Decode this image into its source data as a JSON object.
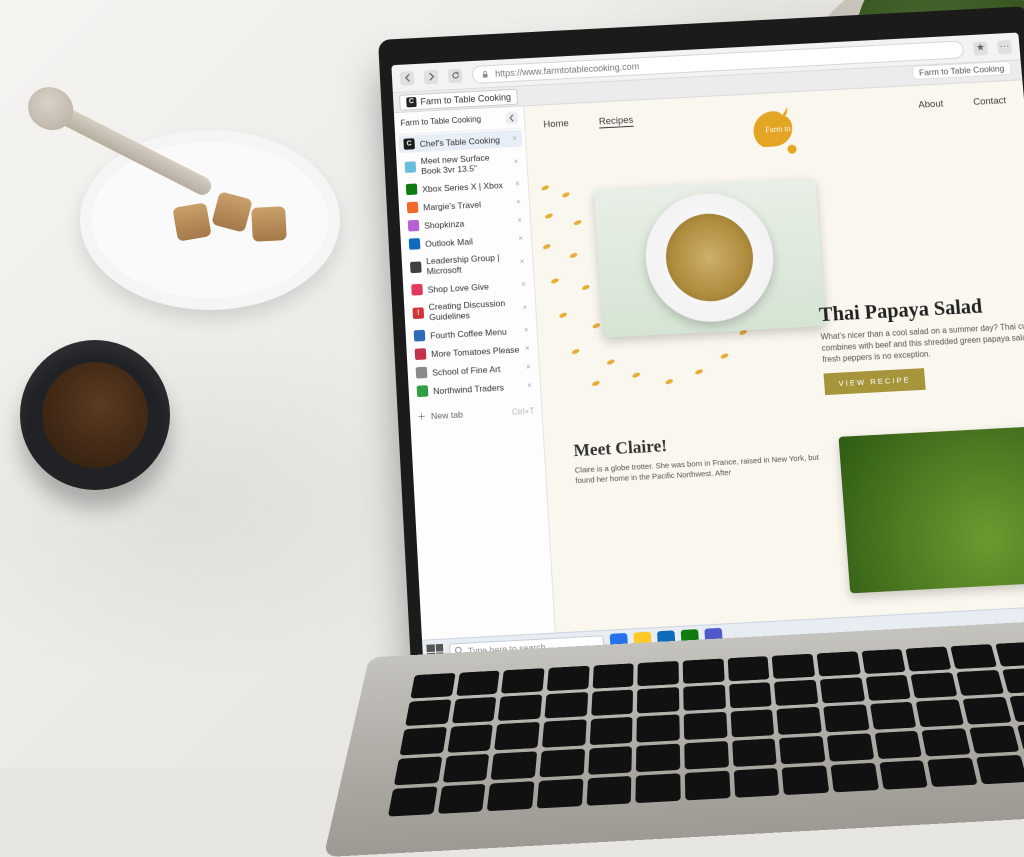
{
  "browser": {
    "url": "https://www.farmtotablecooking.com",
    "account_label": "Farm to Table Cooking",
    "tabstrip_label": "Farm to Table Cooking",
    "sidebar_header": "Farm to Table Cooking",
    "new_tab_label": "New tab",
    "new_tab_shortcut": "Ctrl+T",
    "tabs": [
      {
        "label": "Chef's Table Cooking",
        "color": "#1b1b1b",
        "glyph": "C",
        "active": true
      },
      {
        "label": "Meet new Surface Book 3vr 13.5\"",
        "color": "#6bbedb",
        "glyph": ""
      },
      {
        "label": "Xbox Series X | Xbox",
        "color": "#107c10",
        "glyph": ""
      },
      {
        "label": "Margie's Travel",
        "color": "#f06a2c",
        "glyph": ""
      },
      {
        "label": "Shopkinza",
        "color": "#b560d6",
        "glyph": ""
      },
      {
        "label": "Outlook Mail",
        "color": "#0f6cbd",
        "glyph": ""
      },
      {
        "label": "Leadership Group | Microsoft",
        "color": "#3f3f3f",
        "glyph": ""
      },
      {
        "label": "Shop Love Give",
        "color": "#e23a5e",
        "glyph": ""
      },
      {
        "label": "Creating Discussion Guidelines",
        "color": "#d13438",
        "glyph": "!"
      },
      {
        "label": "Fourth Coffee Menu",
        "color": "#316bb5",
        "glyph": ""
      },
      {
        "label": "More Tomatoes Please",
        "color": "#c4314b",
        "glyph": ""
      },
      {
        "label": "School of Fine Art",
        "color": "#8a8a8a",
        "glyph": ""
      },
      {
        "label": "Northwind Traders",
        "color": "#2f9e44",
        "glyph": ""
      }
    ]
  },
  "site": {
    "nav": {
      "home": "Home",
      "recipes": "Recipes",
      "about": "About",
      "contact": "Contact"
    },
    "logo_script": "Farm to Table",
    "recipe": {
      "title": "Thai Papaya Salad",
      "body": "What's nicer than a cool salad on a summer day? Thai cuisine combines with beef and this shredded green papaya salad with fresh peppers is no exception.",
      "cta": "VIEW RECIPE"
    },
    "meet": {
      "title": "Meet Claire!",
      "body": "Claire is a globe trotter. She was born in France, raised in New York, but found her home in the Pacific Northwest. After"
    }
  },
  "taskbar": {
    "search_placeholder": "Type here to search"
  }
}
